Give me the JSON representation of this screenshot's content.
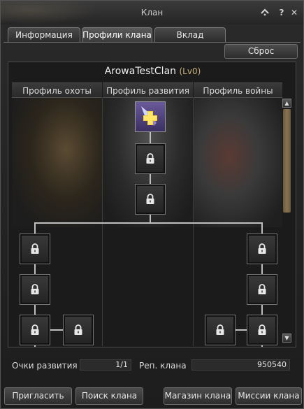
{
  "window": {
    "title": "Клан"
  },
  "titlebar": {
    "icon_names": [
      "settings-icon",
      "help-icon",
      "close-icon"
    ],
    "help_label": "?",
    "close_label": "✕"
  },
  "tabs": [
    {
      "label": "Информация",
      "active": false
    },
    {
      "label": "Профили клана",
      "active": true
    },
    {
      "label": "Вклад",
      "active": false
    }
  ],
  "reset_button": "Сброс",
  "clan": {
    "name": "ArowaTestClan",
    "level": "(Lv0)"
  },
  "columns": [
    {
      "label": "Профиль охоты"
    },
    {
      "label": "Профиль развития"
    },
    {
      "label": "Профиль войны"
    }
  ],
  "tree": {
    "skill_icon": "add-skill-icon",
    "node_icon": "lock-icon"
  },
  "stats": {
    "points_label": "Очки развития",
    "points_value": "1/1",
    "rep_label": "Реп. клана",
    "rep_value": "950540"
  },
  "bottom_buttons": {
    "invite": "Пригласить",
    "search": "Поиск клана",
    "shop": "Магазин клана",
    "missions": "Миссии клана"
  },
  "colors": {
    "skill_accent": "#f5d23a",
    "reputation_text": "#e6e6e6"
  }
}
